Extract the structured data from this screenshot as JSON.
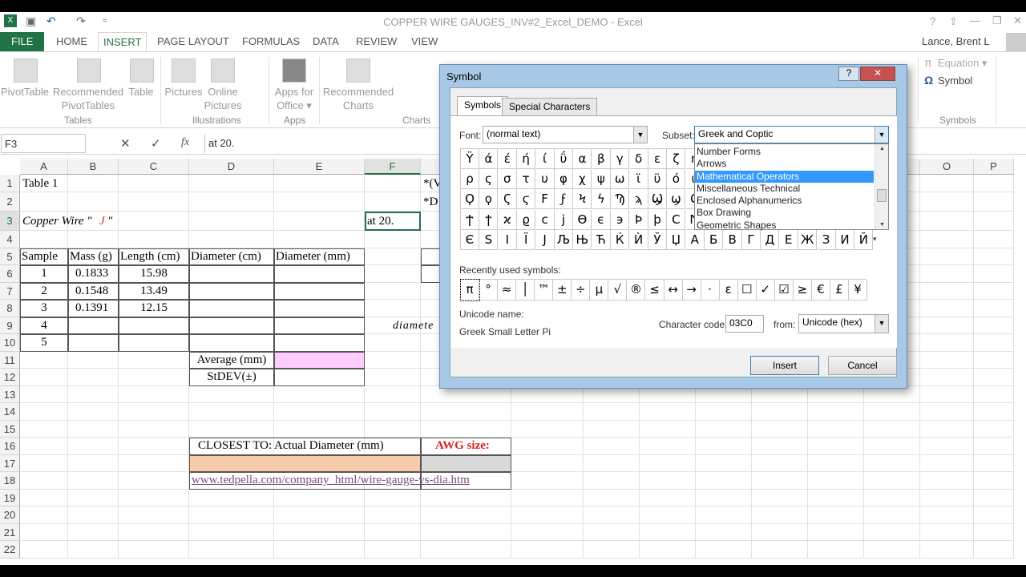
{
  "window": {
    "title": "COPPER WIRE GAUGES_INV#2_Excel_DEMO - Excel",
    "user": "Lance, Brent L",
    "help": "?",
    "minimize": "—",
    "restore": "❐",
    "close": "✕"
  },
  "quick_access": {
    "undo": "↶",
    "redo": "↷",
    "customize": "="
  },
  "tabs": [
    "FILE",
    "HOME",
    "INSERT",
    "PAGE LAYOUT",
    "FORMULAS",
    "DATA",
    "REVIEW",
    "VIEW"
  ],
  "active_tab": "INSERT",
  "ribbon": {
    "buttons": [
      {
        "label": "PivotTable",
        "icon": "pivottable-icon"
      },
      {
        "label": "Recommended PivotTables",
        "icon": "recommended-pivottables-icon"
      },
      {
        "label": "Table",
        "icon": "table-icon"
      },
      {
        "label": "Pictures",
        "icon": "pictures-icon"
      },
      {
        "label": "Online Pictures",
        "icon": "online-pictures-icon"
      },
      {
        "label": "Apps for Office ▾",
        "icon": "apps-icon"
      },
      {
        "label": "Recommended Charts",
        "icon": "recommended-charts-icon"
      }
    ],
    "groups": [
      "Tables",
      "Illustrations",
      "Apps",
      "Charts",
      "Symbols"
    ],
    "equation": "Equation ▾",
    "equation_icon": "π",
    "symbol": "Symbol",
    "symbol_icon": "Ω"
  },
  "formula_bar": {
    "name_box": "F3",
    "cancel": "✕",
    "enter": "✓",
    "fx": "fx",
    "formula": "at 20."
  },
  "sheet": {
    "columns": [
      "A",
      "B",
      "C",
      "D",
      "E",
      "F",
      "G",
      "H",
      "I",
      "J",
      "K",
      "L",
      "M",
      "N",
      "O",
      "P"
    ],
    "rows": [
      "1",
      "2",
      "3",
      "4",
      "5",
      "6",
      "7",
      "8",
      "9",
      "10",
      "11",
      "12",
      "13",
      "14",
      "15",
      "16",
      "17",
      "18",
      "19",
      "20",
      "21",
      "22"
    ],
    "selected_cell": "F3",
    "cells": [
      {
        "ref": "A1",
        "text": "Table 1"
      },
      {
        "ref": "A3",
        "text": "Copper Wire \"",
        "italic": true
      },
      {
        "ref": "A3b",
        "text": "J",
        "italic": true,
        "color": "#e03030"
      },
      {
        "ref": "A3c",
        "text": "\"",
        "italic": true
      },
      {
        "ref": "F3",
        "text": "at 20."
      },
      {
        "ref": "G1",
        "text": "*(V"
      },
      {
        "ref": "G2",
        "text": "*D"
      },
      {
        "ref": "A5",
        "text": "Sample"
      },
      {
        "ref": "B5",
        "text": "Mass (g)"
      },
      {
        "ref": "C5",
        "text": "Length (cm)"
      },
      {
        "ref": "D5",
        "text": "Diameter (cm)"
      },
      {
        "ref": "E5",
        "text": "Diameter (mm)"
      },
      {
        "ref": "A6",
        "text": "1"
      },
      {
        "ref": "B6",
        "text": "0.1833"
      },
      {
        "ref": "C6",
        "text": "15.98"
      },
      {
        "ref": "A7",
        "text": "2"
      },
      {
        "ref": "B7",
        "text": "0.1548"
      },
      {
        "ref": "C7",
        "text": "13.49"
      },
      {
        "ref": "A8",
        "text": "3"
      },
      {
        "ref": "B8",
        "text": "0.1391"
      },
      {
        "ref": "C8",
        "text": "12.15"
      },
      {
        "ref": "A9",
        "text": "4"
      },
      {
        "ref": "A10",
        "text": "5"
      },
      {
        "ref": "D11",
        "text": "Average (mm)"
      },
      {
        "ref": "D12",
        "text": "StDEV(±)"
      },
      {
        "ref": "G9",
        "text": "diamete",
        "italic": true
      },
      {
        "ref": "D16",
        "text": "CLOSEST TO: Actual Diameter (mm)"
      },
      {
        "ref": "G16",
        "text": "AWG size:",
        "bold": true,
        "color": "#e02020"
      },
      {
        "ref": "D18",
        "text": "www.tedpella.com/company_html/wire-gauge-vs-dia.htm",
        "link": true
      }
    ],
    "fills": {
      "average": "#ffccff",
      "closest": "#f8cbad",
      "awg": "#d9d9d9"
    }
  },
  "dialog": {
    "title": "Symbol",
    "help": "?",
    "close": "✕",
    "tabs": [
      "Symbols",
      "Special Characters"
    ],
    "font_label": "Font:",
    "font_value": "(normal text)",
    "subset_label": "Subset:",
    "subset_value": "Greek and Coptic",
    "subset_options": [
      "Number Forms",
      "Arrows",
      "Mathematical Operators",
      "Miscellaneous Technical",
      "Enclosed Alphanumerics",
      "Box Drawing",
      "Geometric Shapes"
    ],
    "subset_highlighted": "Mathematical Operators",
    "grid": [
      [
        "Ÿ",
        "ά",
        "έ",
        "ή",
        "ί",
        "ΰ",
        "α",
        "β",
        "γ",
        "δ",
        "ε",
        "ζ",
        "η"
      ],
      [
        "ρ",
        "ς",
        "σ",
        "τ",
        "υ",
        "φ",
        "χ",
        "ψ",
        "ω",
        "ϊ",
        "ϋ",
        "ό",
        "ύ"
      ],
      [
        "Ϙ",
        "ϙ",
        "Ϛ",
        "ϛ",
        "Ϝ",
        "ϝ",
        "Ϟ",
        "ϟ",
        "Ϡ",
        "ϡ",
        "Ϣ",
        "ϣ",
        "Ϥ"
      ],
      [
        "Ϯ",
        "ϯ",
        "ϰ",
        "ϱ",
        "ϲ",
        "ϳ",
        "ϴ",
        "ϵ",
        "϶",
        "Ϸ",
        "ϸ",
        "Ϲ",
        "Ϻ"
      ],
      [
        "Є",
        "Ѕ",
        "І",
        "Ї",
        "Ј",
        "Љ",
        "Њ",
        "Ћ",
        "Ќ",
        "Ѝ",
        "Ў",
        "Џ",
        "А",
        "Б",
        "В",
        "Г",
        "Д",
        "Е",
        "Ж",
        "З",
        "И",
        "Й"
      ]
    ],
    "recent_label": "Recently used symbols:",
    "recent": [
      "π",
      "°",
      "≈",
      "│",
      "™",
      "±",
      "÷",
      "µ",
      "√",
      "®",
      "≤",
      "↔",
      "→",
      "·",
      "ε",
      "☐",
      "✓",
      "☑",
      "≥",
      "€",
      "£",
      "¥"
    ],
    "unicode_name_label": "Unicode name:",
    "unicode_name": "Greek Small Letter Pi",
    "char_code_label": "Character code:",
    "char_code": "03C0",
    "from_label": "from:",
    "from_value": "Unicode (hex)",
    "insert": "Insert",
    "cancel": "Cancel"
  }
}
